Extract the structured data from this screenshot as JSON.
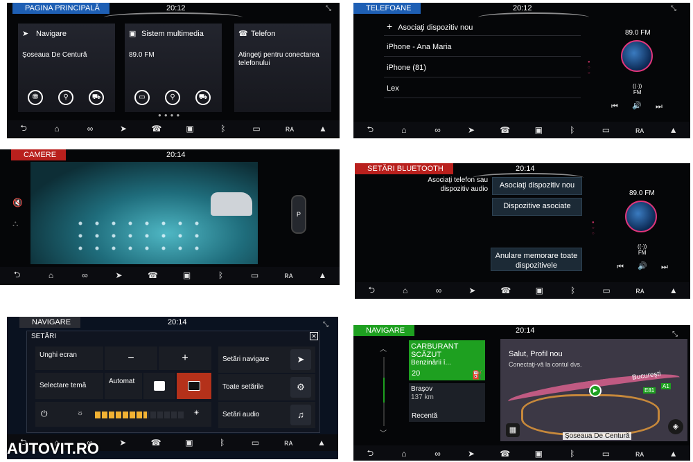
{
  "colors": {
    "blue_tag": "#1e5fb4",
    "red_tag": "#b9201d",
    "green_tag": "#1ea020",
    "nav_bg": "#0b0c10",
    "radio_ring": "#e0357a"
  },
  "nav_icons": [
    "back-icon",
    "home-icon",
    "apps-icon",
    "navigation-icon",
    "phone-icon",
    "media-icon",
    "bluetooth-icon",
    "camera-icon",
    "radio-icon",
    "mountain-icon"
  ],
  "nav_glyphs": [
    "⮌",
    "⌂",
    "∞",
    "➤",
    "☎",
    "▣",
    "ᛒ",
    "▭",
    "ʀᴀ",
    "▲"
  ],
  "p1": {
    "tag": "PAGINA PRINCIPALĂ",
    "time": "20:12",
    "tiles": [
      {
        "title": "Navigare",
        "line": "Şoseaua De Centură"
      },
      {
        "title": "Sistem multimedia",
        "line": "89.0 FM"
      },
      {
        "title": "Telefon",
        "line": "Atingeţi pentru conectarea telefonului"
      }
    ],
    "round_icons": [
      "⛃",
      "⚲",
      "⛟",
      "▭",
      "⚲",
      "⛟"
    ]
  },
  "p2": {
    "tag": "TELEFOANE",
    "time": "20:12",
    "add": "Asociaţi dispozitiv nou",
    "devices": [
      "iPhone - Ana Maria",
      "iPhone (81)",
      "Lex"
    ],
    "station": "89.0 FM",
    "fm": "FM",
    "ctrl": [
      "⏮",
      "🔊",
      "⏭"
    ]
  },
  "p3": {
    "tag": "CAMERE",
    "time": "20:14",
    "car_label": "P"
  },
  "p4": {
    "tag": "SETĂRI BLUETOOTH",
    "time": "20:14",
    "hint": "Asociaţi telefon sau dispozitiv audio",
    "btn1": "Asociaţi dispozitiv nou",
    "btn2": "Dispozitive asociate",
    "btn3": "Anulare memorare toate dispozitivele",
    "station": "89.0 FM",
    "fm": "FM",
    "ctrl": [
      "⏮",
      "🔊",
      "⏭"
    ]
  },
  "p5": {
    "tag": "NAVIGARE",
    "time": "20:14",
    "dialog_title": "SETĂRI",
    "close": "✕",
    "angle": "Unghi ecran",
    "minus": "−",
    "plus": "+",
    "theme": "Selectare temă afişaj",
    "auto": "Automat",
    "nav_set": "Setări navigare",
    "all_set": "Toate setările",
    "audio_set": "Setări audio",
    "brightness": 0.58
  },
  "p6": {
    "tag": "NAVIGARE",
    "time": "20:14",
    "card1_title": "CARBURANT SCĂZUT",
    "card1_sub": "Benzinării î...",
    "card1_num": "20",
    "card2_city": "Braşov",
    "card2_dist": "137 km",
    "card2_label": "Recentă",
    "greet": "Salut, Profil nou",
    "greet_sub": "Conectaţi-vă la contul dvs.",
    "road": "Şoseaua De Centură",
    "map_city": "Bucureşti",
    "shield1": "E81",
    "shield2": "A1"
  },
  "watermark": "AUTOVIT.RO"
}
